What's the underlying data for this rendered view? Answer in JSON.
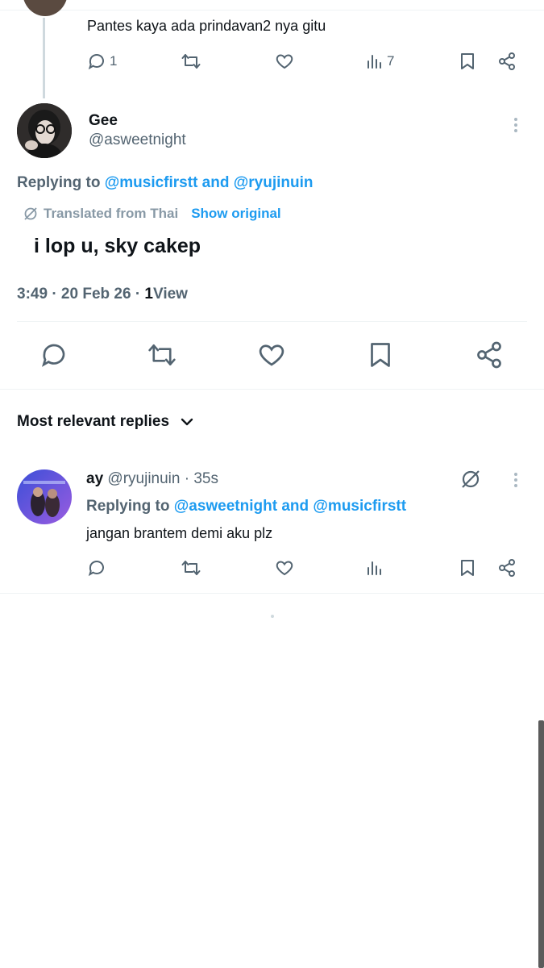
{
  "prev_tweet": {
    "text": "Pantes kaya ada prindavan2 nya gitu",
    "reply_count": "1",
    "view_count": "7"
  },
  "main_tweet": {
    "display_name": "Gee",
    "handle": "@asweetnight",
    "replying_prefix": "Replying to ",
    "replying_user1": "@musicfirstt",
    "replying_and": " and ",
    "replying_user2": "@ryujinuin",
    "translated_label": "Translated from Thai",
    "show_original": "Show original",
    "text": "i lop u, sky cakep",
    "time": "3:49",
    "date": "20 Feb 26",
    "views_count": "1",
    "views_label": "View"
  },
  "sort": {
    "label": "Most relevant replies"
  },
  "reply": {
    "display_name": "ay",
    "handle": "@ryujinuin",
    "time": "· 35s",
    "replying_prefix": "Replying to ",
    "replying_user1": "@asweetnight",
    "replying_and": " and ",
    "replying_user2": "@musicfirstt",
    "text": "jangan brantem demi aku plz"
  },
  "colors": {
    "accent": "#1d9bf0",
    "muted": "#536471",
    "text": "#0f1419"
  }
}
